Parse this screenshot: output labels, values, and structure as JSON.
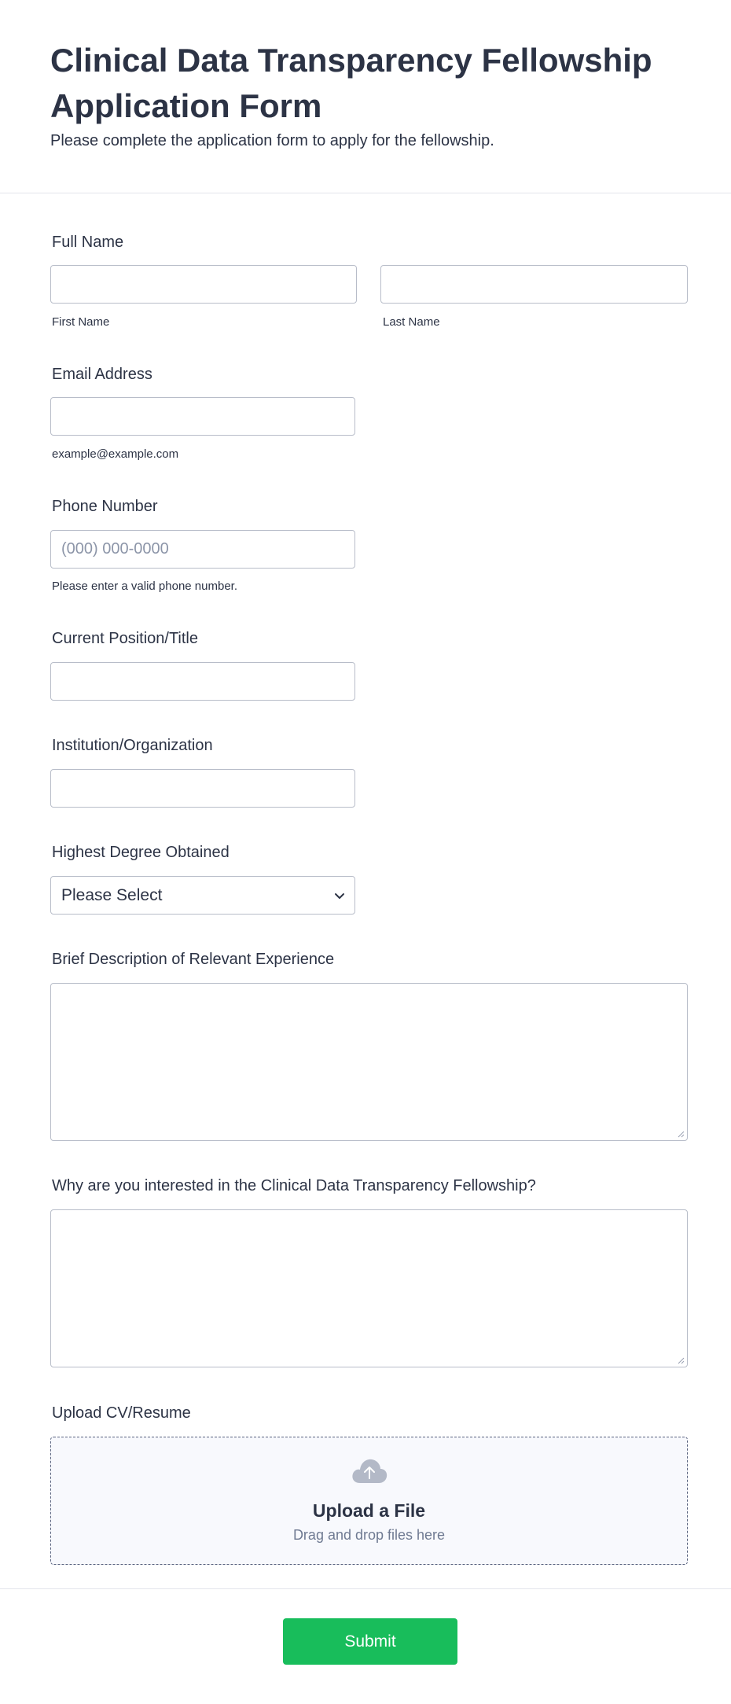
{
  "header": {
    "title": "Clinical Data Transparency Fellowship Application Form",
    "subtitle": "Please complete the application form to apply for the fellowship."
  },
  "full_name": {
    "label": "Full Name",
    "first_sublabel": "First Name",
    "last_sublabel": "Last Name",
    "first_value": "",
    "last_value": ""
  },
  "email": {
    "label": "Email Address",
    "value": "",
    "sublabel": "example@example.com"
  },
  "phone": {
    "label": "Phone Number",
    "placeholder": "(000) 000-0000",
    "value": "",
    "sublabel": "Please enter a valid phone number."
  },
  "position": {
    "label": "Current Position/Title",
    "value": ""
  },
  "institution": {
    "label": "Institution/Organization",
    "value": ""
  },
  "degree": {
    "label": "Highest Degree Obtained",
    "selected": "Please Select",
    "icon": "chevron-down-icon"
  },
  "experience": {
    "label": "Brief Description of Relevant Experience",
    "value": ""
  },
  "interest": {
    "label": "Why are you interested in the Clinical Data Transparency Fellowship?",
    "value": ""
  },
  "upload": {
    "label": "Upload CV/Resume",
    "title": "Upload a File",
    "hint": "Drag and drop files here",
    "icon": "cloud-upload-icon"
  },
  "submit": {
    "label": "Submit"
  },
  "colors": {
    "accent": "#18bd5b",
    "text": "#2c3345",
    "border": "#b8bdc9",
    "upload_bg": "#f8f9fd",
    "placeholder": "#8c95a8"
  }
}
